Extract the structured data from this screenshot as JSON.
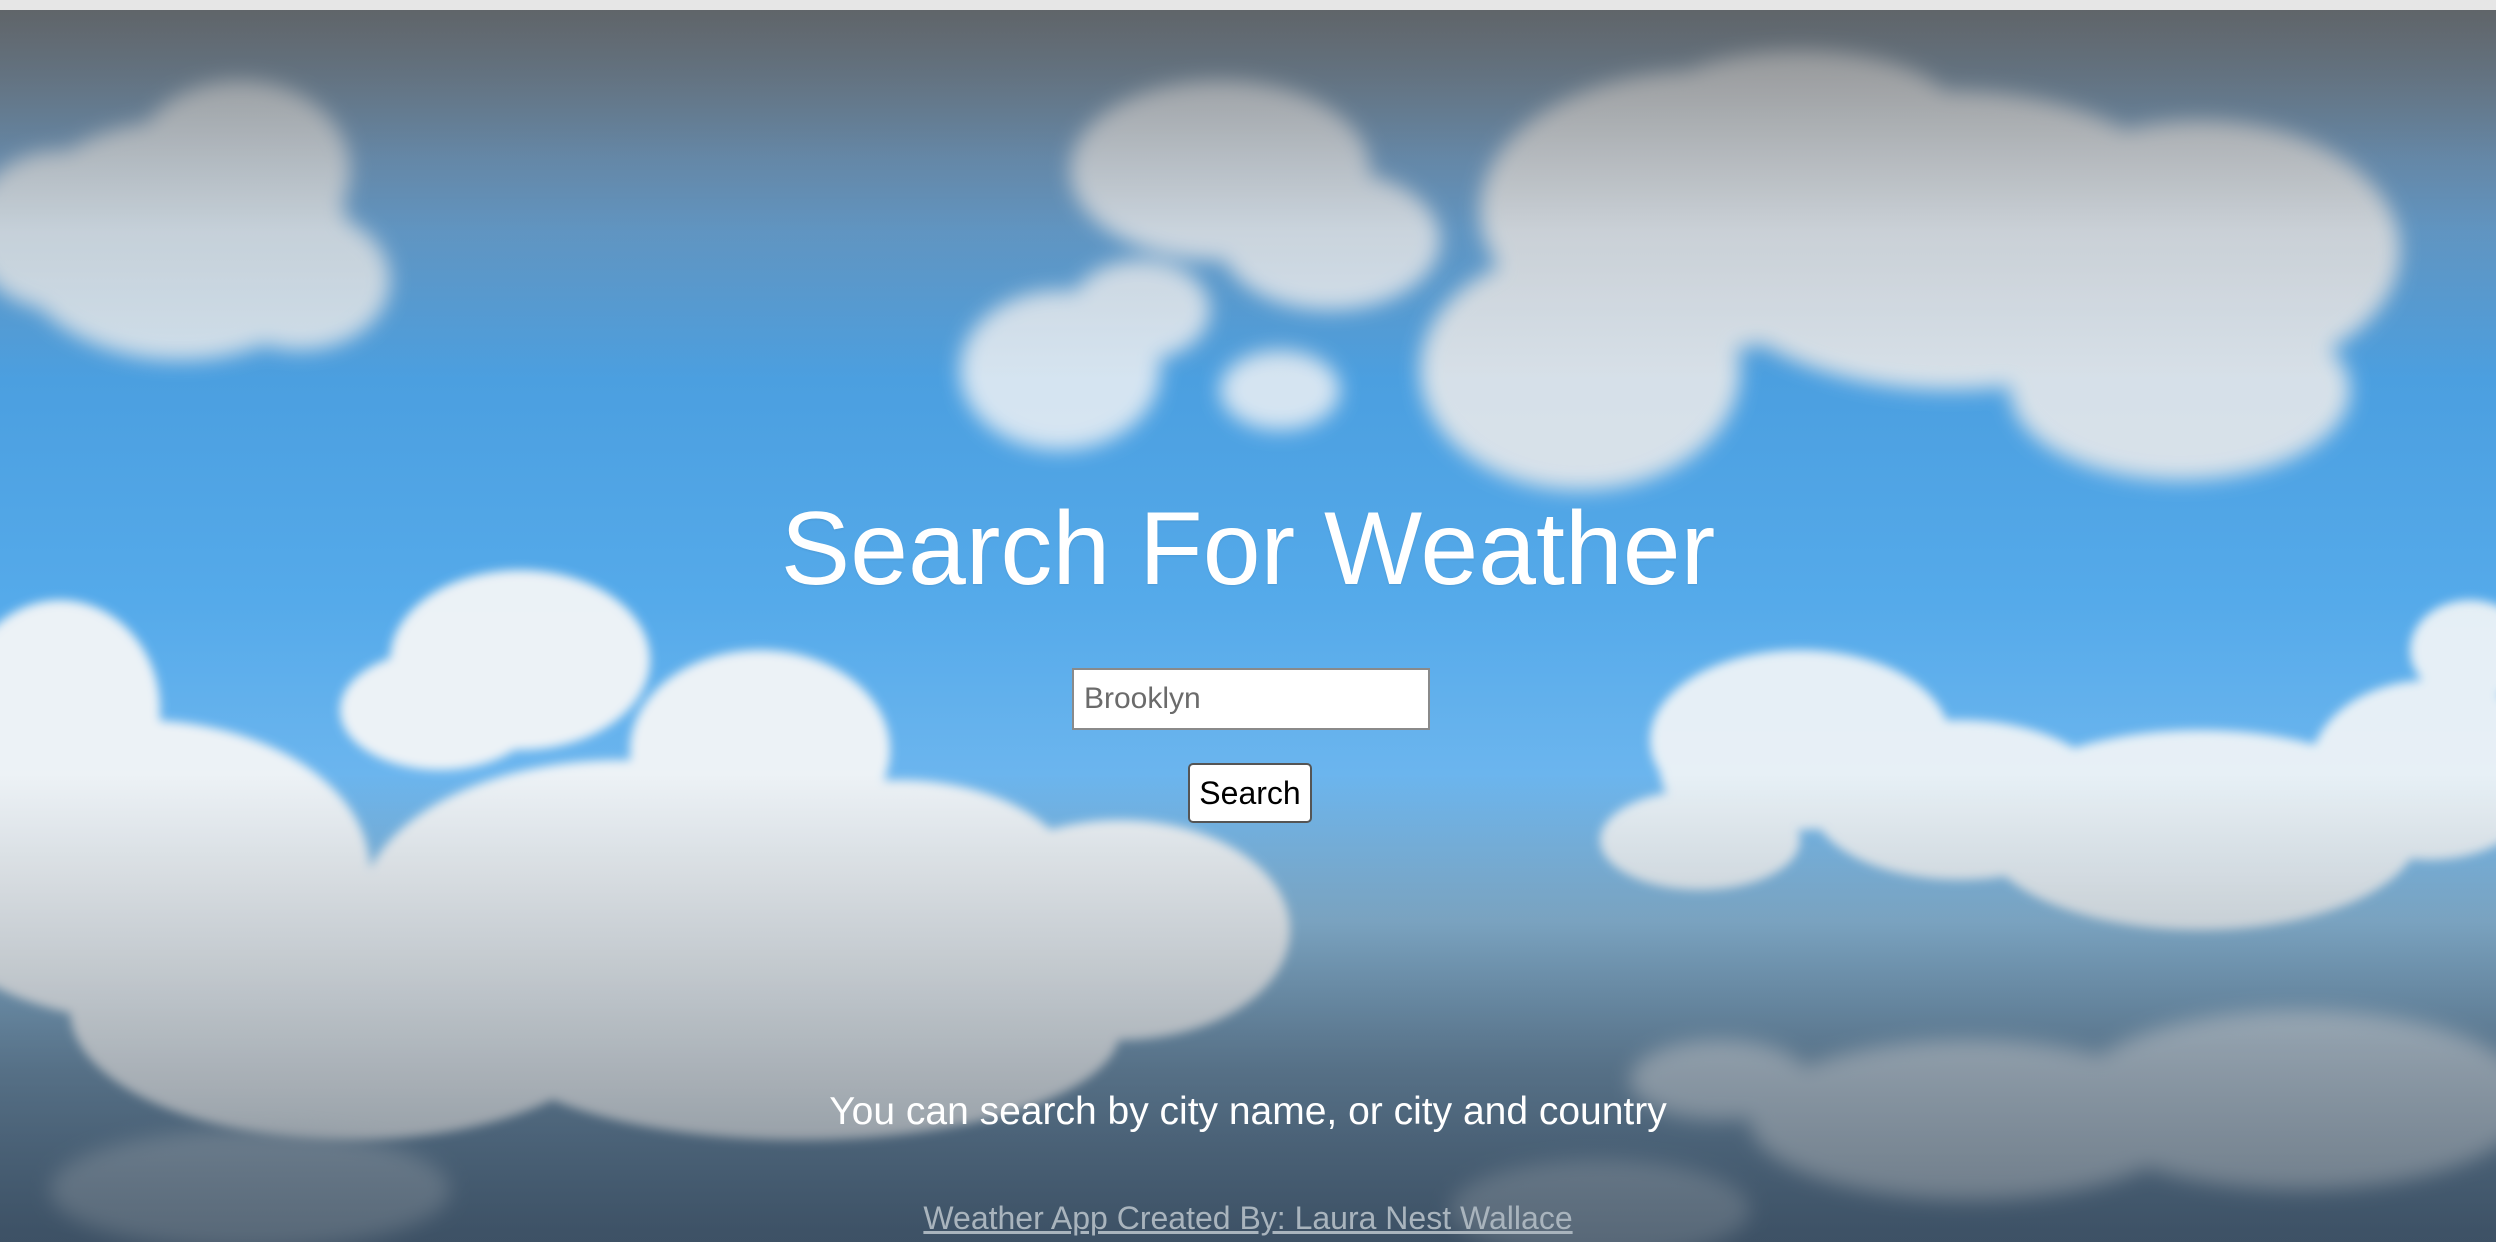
{
  "page": {
    "title": "Search For Weather",
    "hint": "You can search by city name, or city and country",
    "credit_link": "Weather App Created By: Laura Nest Wallace"
  },
  "search": {
    "placeholder": "Brooklyn",
    "value": "",
    "button_label": "Search"
  },
  "colors": {
    "sky": "#4b9fe0",
    "text": "#ffffff",
    "link": "#a9b4bd"
  },
  "background": {
    "icon": "cloudy-sky-image"
  }
}
